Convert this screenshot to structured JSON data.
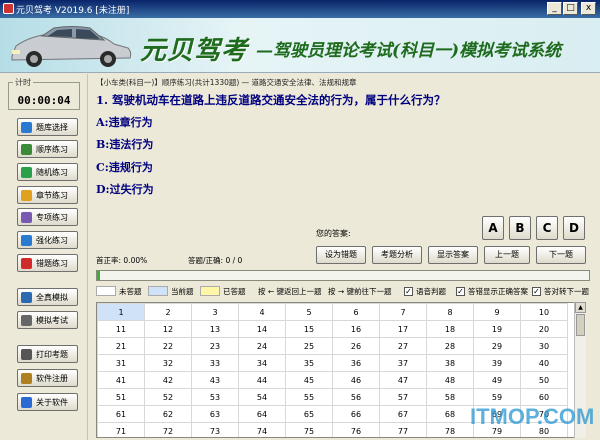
{
  "window": {
    "title": "元贝驾考 V2019.6 [未注册]",
    "min": "_",
    "max": "□",
    "close": "x"
  },
  "banner": {
    "brand": "元贝驾考",
    "subtitle": "—驾驶员理论考试(科目一)模拟考试系统"
  },
  "timer": {
    "label": "计时",
    "value": "00:00:04"
  },
  "sidebar": {
    "items": [
      {
        "label": "题库选择",
        "icon": "library-icon",
        "color": "#2a7ad2"
      },
      {
        "label": "顺序练习",
        "icon": "sequence-icon",
        "color": "#3a8a3a"
      },
      {
        "label": "随机练习",
        "icon": "shuffle-icon",
        "color": "#2aa04a"
      },
      {
        "label": "章节练习",
        "icon": "folder-icon",
        "color": "#e0a020"
      },
      {
        "label": "专项练习",
        "icon": "checklist-icon",
        "color": "#7a5ab0"
      },
      {
        "label": "强化练习",
        "icon": "grid-icon",
        "color": "#2a7ad2"
      },
      {
        "label": "错题练习",
        "icon": "flag-icon",
        "color": "#d02a2a"
      },
      {
        "label": "全真模拟",
        "icon": "monitor-icon",
        "color": "#2a6ab0"
      },
      {
        "label": "模拟考试",
        "icon": "document-icon",
        "color": "#666666"
      },
      {
        "label": "打印考题",
        "icon": "printer-icon",
        "color": "#555555"
      },
      {
        "label": "软件注册",
        "icon": "key-icon",
        "color": "#b08020"
      },
      {
        "label": "关于软件",
        "icon": "info-icon",
        "color": "#2a6ad2"
      }
    ]
  },
  "question": {
    "header": "【小车类(科目一)】顺序练习(共计1330题) — 道路交通安全法律、法规和规章",
    "text": "1. 驾驶机动车在道路上违反道路交通安全法的行为，属于什么行为？",
    "options": [
      "A:违章行为",
      "B:违法行为",
      "C:违规行为",
      "D:过失行为"
    ]
  },
  "answer": {
    "label": "您的答案:",
    "choices": [
      "A",
      "B",
      "C",
      "D"
    ]
  },
  "stats": {
    "accuracy": "首正率: 0.00%",
    "count": "答题/正确: 0 / 0"
  },
  "actions": {
    "mark_wrong": "设为错题",
    "analysis": "考题分析",
    "show_answer": "显示答案",
    "prev": "上一题",
    "next": "下一题"
  },
  "progress": {
    "fraction": 0.006
  },
  "legend": {
    "unanswered": "未答题",
    "current": "当前题",
    "answered": "已答题",
    "key_prev": "按 ← 键返回上一题",
    "key_next": "按 → 键前往下一题",
    "voice": "语音判题",
    "wrong_show": "答错显示正确答案",
    "auto_next": "答对转下一题",
    "check": "✓",
    "colors": {
      "unanswered": "#ffffff",
      "current": "#cfe2f7",
      "answered": "#fff6a8"
    }
  },
  "grid": {
    "rows": [
      [
        "1",
        "2",
        "3",
        "4",
        "5",
        "6",
        "7",
        "8",
        "9",
        "10"
      ],
      [
        "11",
        "12",
        "13",
        "14",
        "15",
        "16",
        "17",
        "18",
        "19",
        "20"
      ],
      [
        "21",
        "22",
        "23",
        "24",
        "25",
        "26",
        "27",
        "28",
        "29",
        "30"
      ],
      [
        "31",
        "32",
        "33",
        "34",
        "35",
        "36",
        "37",
        "38",
        "39",
        "40"
      ],
      [
        "41",
        "42",
        "43",
        "44",
        "45",
        "46",
        "47",
        "48",
        "49",
        "50"
      ],
      [
        "51",
        "52",
        "53",
        "54",
        "55",
        "56",
        "57",
        "58",
        "59",
        "60"
      ],
      [
        "61",
        "62",
        "63",
        "64",
        "65",
        "66",
        "67",
        "68",
        "69",
        "70"
      ],
      [
        "71",
        "72",
        "73",
        "74",
        "75",
        "76",
        "77",
        "78",
        "79",
        "80"
      ]
    ]
  },
  "watermark": "ITMOP.COM"
}
